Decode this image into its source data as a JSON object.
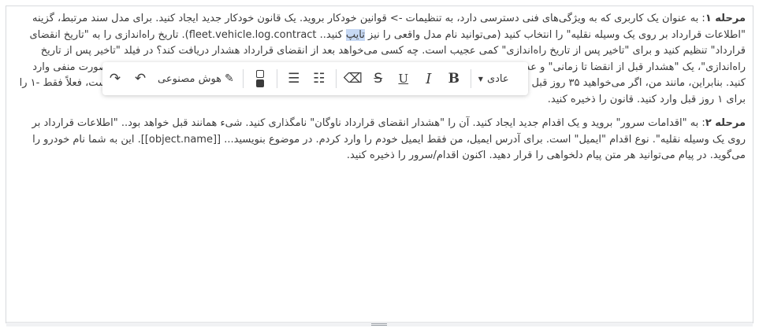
{
  "content": {
    "p1_label": "مرحله ۱",
    "p1_text1": ": به عنوان یک کاربری که به ویژگی‌های فنی دسترسی دارد، به تنظیمات -> قوانین خودکار بروید. یک قانون خودکار جدید ایجاد کنید. برای مدل سند مرتبط، گزینه \"اطلاعات قرارداد بر روی یک وسیله نقلیه\" را انتخاب کنید (می‌توانید نام مدل واقعی را نیز ",
    "p1_highlight": "تایپ",
    "p1_text2": " کنید.. fleet.vehicle.log.contract). تاریخ راه‌اندازی را به \"تاریخ انقضای قرارداد\" تنظیم کنید و برای \"تاخیر پس از تاریخ راه‌اندازی\" کمی عجیب است. چه کسی می‌خواهد بعد از انقضای قرارداد هشدار دریافت کند؟ در فیلد \"تاخیر پس از تاریخ راه‌اندازی\"، یک \"هشدار قبل از انقضا تا زمانی\" و عدد باید به یک عدد منفی تبدیل شود. به نظر من، هرچند... برای داشتن یک راه‌حل کارا، باید عدد را به صورت منفی وارد کنید. بنابراین، مانند من، اگر می‌خواهید ۳۵ روز قبل از انقضا هشدار دریافت کنید، در فیلد \"تاخیر پس از تاریخ راه‌اندازی\" عدد -۳۵ را وارد کنید. اما برای تست، فعلاً فقط -۱ را برای ۱ روز قبل وارد کنید. قانون را ذخیره کنید.",
    "p2_label": "مرحله ۲",
    "p2_text": ": به \"اقدامات سرور\" بروید و یک اقدام جدید ایجاد کنید. آن را \"هشدار انقضای قرارداد ناوگان\" نامگذاری کنید. شیء همانند قبل خواهد بود.. \"اطلاعات قرارداد بر روی یک وسیله نقلیه\". نوع اقدام \"ایمیل\" است. برای آدرس ایمیل، من فقط ایمیل خودم را وارد کردم. در موضوع بنویسید... [[object.name]]. این به شما نام خودرو را می‌گوید. در پیام می‌توانید هر متن پیام دلخواهی را قرار دهید. اکنون اقدام/سرور را ذخیره کنید."
  },
  "toolbar": {
    "style_label": "عادی",
    "ai_label": "هوش مصنوعی",
    "bold": "B",
    "italic": "I",
    "underline": "U",
    "strike": "S",
    "eraser": "⌫",
    "undo": "↶",
    "redo": "↷"
  }
}
